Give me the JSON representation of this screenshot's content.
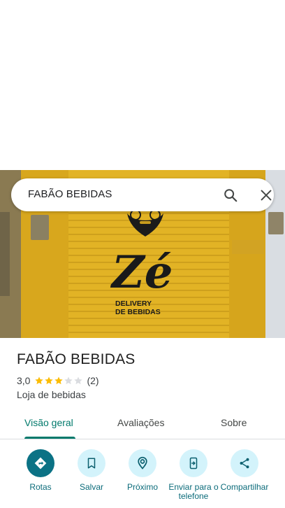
{
  "search": {
    "value": "FABÃO BEBIDAS"
  },
  "place": {
    "name": "FABÃO BEBIDAS",
    "rating": "3,0",
    "stars_value": 3,
    "stars_max": 5,
    "review_count": "(2)",
    "category": "Loja de bebidas"
  },
  "photo": {
    "sign_text_1": "DELIVERY",
    "sign_text_2": "DE BEBIDAS",
    "logo_text": "Zé"
  },
  "tabs": [
    {
      "label": "Visão geral",
      "active": true
    },
    {
      "label": "Avaliações",
      "active": false
    },
    {
      "label": "Sobre",
      "active": false
    }
  ],
  "actions": [
    {
      "label": "Rotas",
      "icon": "directions-icon"
    },
    {
      "label": "Salvar",
      "icon": "bookmark-icon"
    },
    {
      "label": "Próximo",
      "icon": "nearby-icon"
    },
    {
      "label": "Enviar para o telefone",
      "icon": "send-to-phone-icon"
    },
    {
      "label": "Compartilhar",
      "icon": "share-icon"
    }
  ],
  "colors": {
    "accent": "#00796b",
    "action_bg": "#d3f3fb",
    "primary_action": "#0b7285",
    "star": "#fbbc04",
    "star_empty": "#dadce0"
  }
}
